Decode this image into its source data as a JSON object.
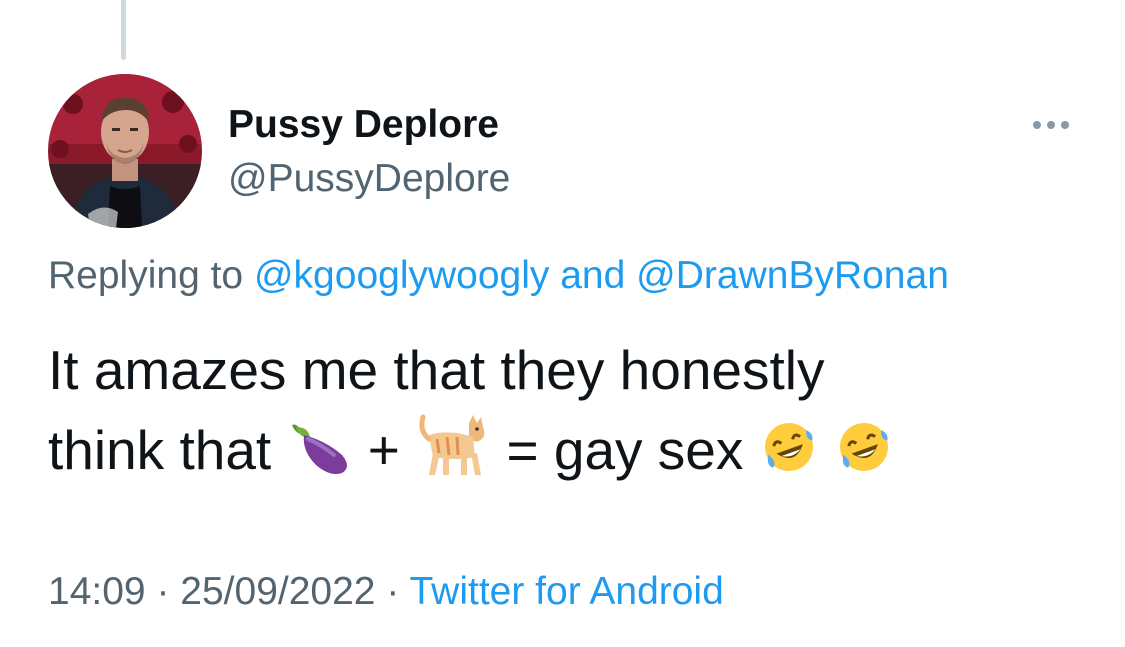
{
  "author": {
    "display_name": "Pussy Deplore",
    "handle": "@PussyDeplore"
  },
  "reply": {
    "prefix": "Replying to",
    "mention_1": "@kgooglywoogly",
    "joiner": "and",
    "mention_2": "@DrawnByRonan"
  },
  "tweet": {
    "line_1": "It amazes me that they honestly",
    "line_2_start": "think that",
    "emoji_1": "eggplant",
    "plus": "+",
    "emoji_2": "cat",
    "line_2_end": "= gay sex",
    "emoji_3": "rolling-on-floor-laughing",
    "emoji_4": "rolling-on-floor-laughing"
  },
  "meta": {
    "time": "14:09",
    "separator_1": "·",
    "date": "25/09/2022",
    "separator_2": "·",
    "source": "Twitter for Android"
  },
  "icons": {
    "more": "more-horizontal-icon"
  },
  "colors": {
    "text": "#0f1419",
    "secondary": "#536471",
    "link": "#1d9bf0",
    "thread_line": "#cfd9de"
  }
}
